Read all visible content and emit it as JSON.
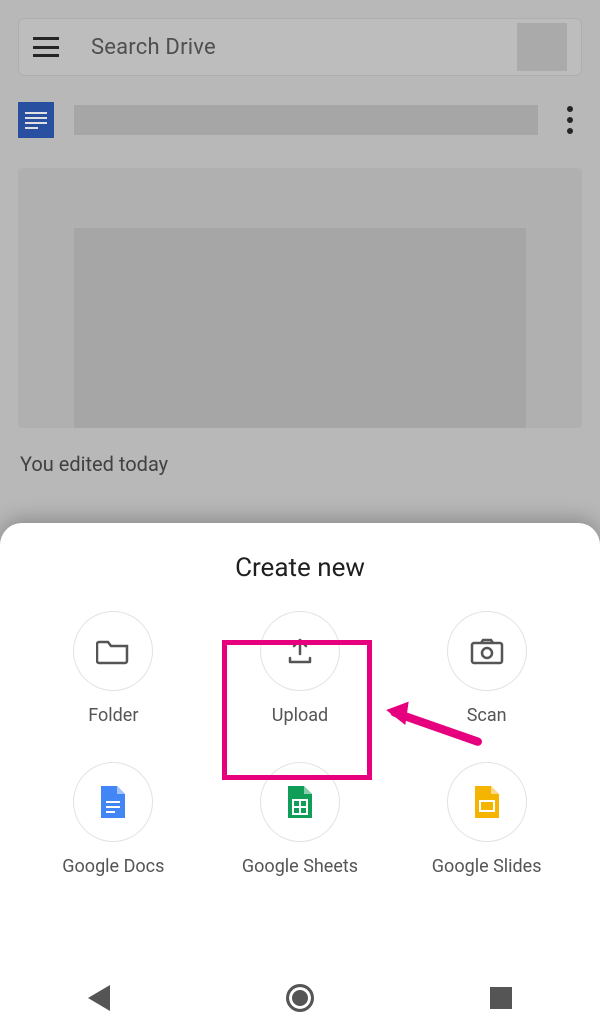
{
  "search": {
    "placeholder": "Search Drive"
  },
  "file": {
    "subline": "You edited today"
  },
  "sheet": {
    "title": "Create new",
    "items": [
      {
        "label": "Folder",
        "icon": "folder"
      },
      {
        "label": "Upload",
        "icon": "upload"
      },
      {
        "label": "Scan",
        "icon": "camera"
      },
      {
        "label": "Google Docs",
        "icon": "docs"
      },
      {
        "label": "Google Sheets",
        "icon": "sheets"
      },
      {
        "label": "Google Slides",
        "icon": "slides"
      }
    ]
  },
  "annotation": {
    "highlighted": "Upload"
  }
}
